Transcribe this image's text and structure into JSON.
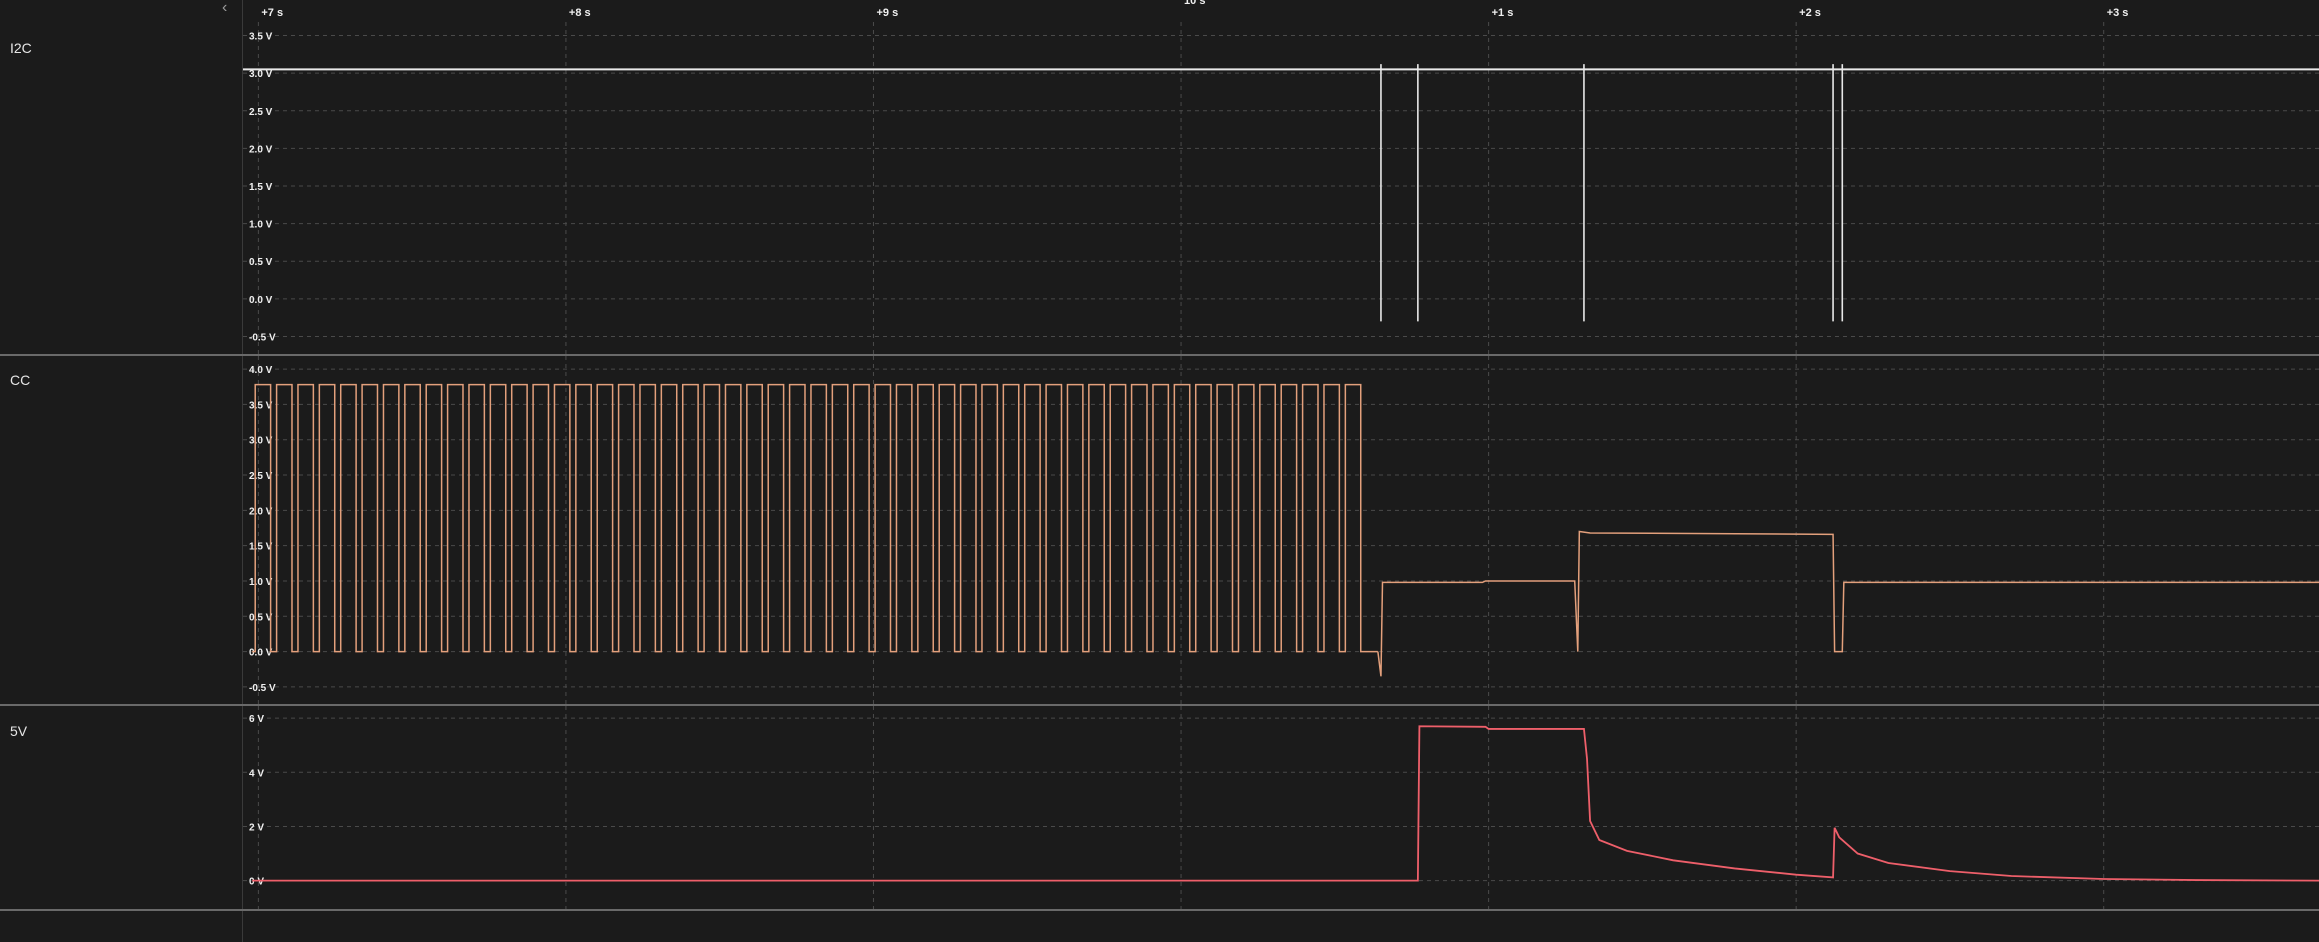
{
  "window": {
    "collapse_icon": "chevron-left-icon"
  },
  "time_axis": {
    "ticks": [
      {
        "t": 7,
        "label": "+7 s"
      },
      {
        "t": 8,
        "label": "+8 s"
      },
      {
        "t": 9,
        "label": "+9 s"
      },
      {
        "t": 10,
        "label": "10 s"
      },
      {
        "t": 11,
        "label": "+1 s"
      },
      {
        "t": 12,
        "label": "+2 s"
      },
      {
        "t": 13,
        "label": "+3 s"
      }
    ],
    "range": [
      6.95,
      13.7
    ]
  },
  "colors": {
    "background": "#1b1b1b",
    "grid": "#4a4a4a",
    "i2c": "#e8e8e8",
    "cc": "#e3a07c",
    "fivev": "#ee5f6a"
  },
  "chart_data": [
    {
      "type": "line",
      "name": "I2C",
      "ylabel_ticks": [
        "3.5 V",
        "3.0 V",
        "2.5 V",
        "2.0 V",
        "1.5 V",
        "1.0 V",
        "0.5 V",
        "0.0 V",
        "-0.5 V"
      ],
      "tick_values": [
        3.5,
        3.0,
        2.5,
        2.0,
        1.5,
        1.0,
        0.5,
        0.0,
        -0.5
      ],
      "ylim": [
        -0.6,
        3.6
      ],
      "baseline": 3.05,
      "glitches": [
        {
          "t": 10.65,
          "low": -0.3,
          "high": 3.12
        },
        {
          "t": 10.77,
          "low": -0.3,
          "high": 3.12
        },
        {
          "t": 11.31,
          "low": -0.3,
          "high": 3.12
        },
        {
          "t": 12.12,
          "low": -0.3,
          "high": 3.12
        },
        {
          "t": 12.15,
          "low": -0.3,
          "high": 3.12
        }
      ]
    },
    {
      "type": "line",
      "name": "CC",
      "ylabel_ticks": [
        "4.0 V",
        "3.5 V",
        "3.0 V",
        "2.5 V",
        "2.0 V",
        "1.5 V",
        "1.0 V",
        "0.5 V",
        "0.0 V",
        "-0.5 V"
      ],
      "tick_values": [
        4.0,
        3.5,
        3.0,
        2.5,
        2.0,
        1.5,
        1.0,
        0.5,
        0.0,
        -0.5
      ],
      "ylim": [
        -0.6,
        4.1
      ],
      "square_wave": {
        "start": 6.98,
        "end": 10.64,
        "period": 0.0695,
        "duty": 0.72,
        "high": 3.78,
        "low": 0.0
      },
      "points": [
        [
          10.64,
          0.0
        ],
        [
          10.65,
          -0.35
        ],
        [
          10.655,
          0.98
        ],
        [
          10.98,
          0.98
        ],
        [
          10.99,
          1.0
        ],
        [
          11.28,
          1.0
        ],
        [
          11.29,
          0.0
        ],
        [
          11.295,
          1.7
        ],
        [
          11.33,
          1.68
        ],
        [
          12.12,
          1.66
        ],
        [
          12.125,
          0.0
        ],
        [
          12.15,
          0.0
        ],
        [
          12.155,
          0.98
        ],
        [
          13.7,
          0.98
        ]
      ]
    },
    {
      "type": "line",
      "name": "5V",
      "ylabel_ticks": [
        "6 V",
        "4 V",
        "2 V",
        "0 V"
      ],
      "tick_values": [
        6,
        4,
        2,
        0
      ],
      "ylim": [
        -0.9,
        6.3
      ],
      "points": [
        [
          6.98,
          0.0
        ],
        [
          10.77,
          0.0
        ],
        [
          10.775,
          5.7
        ],
        [
          10.99,
          5.68
        ],
        [
          11.0,
          5.6
        ],
        [
          11.31,
          5.6
        ],
        [
          11.32,
          4.5
        ],
        [
          11.33,
          2.2
        ],
        [
          11.36,
          1.5
        ],
        [
          11.45,
          1.1
        ],
        [
          11.6,
          0.75
        ],
        [
          11.8,
          0.45
        ],
        [
          12.0,
          0.22
        ],
        [
          12.12,
          0.12
        ],
        [
          12.125,
          1.95
        ],
        [
          12.14,
          1.6
        ],
        [
          12.2,
          1.0
        ],
        [
          12.3,
          0.65
        ],
        [
          12.5,
          0.35
        ],
        [
          12.7,
          0.17
        ],
        [
          13.0,
          0.06
        ],
        [
          13.3,
          0.02
        ],
        [
          13.7,
          0.0
        ]
      ]
    }
  ]
}
